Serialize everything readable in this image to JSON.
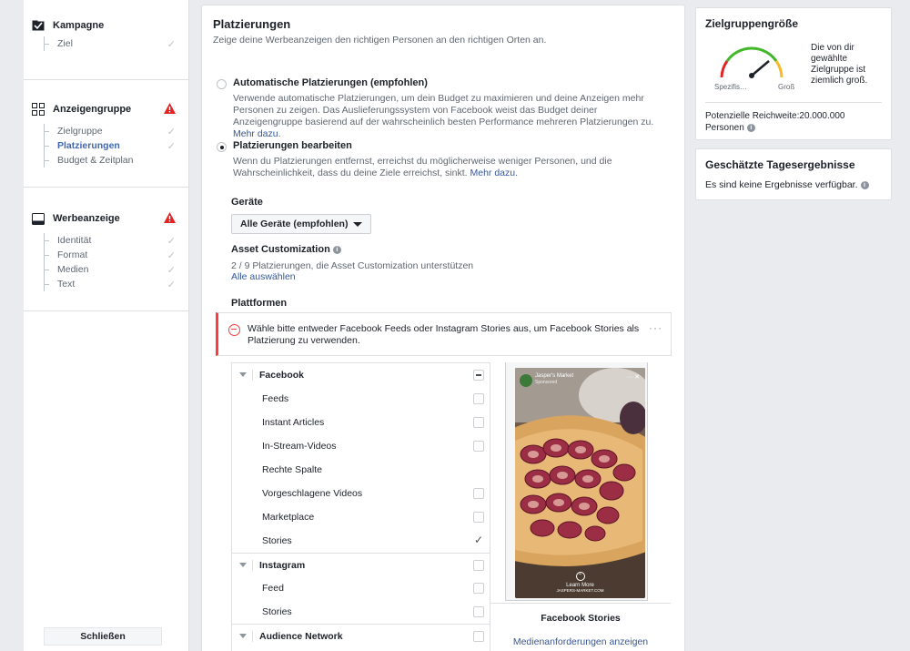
{
  "leftnav": {
    "sections": [
      {
        "title": "Kampagne",
        "icon": "campaign-icon",
        "warning": false,
        "items": [
          {
            "label": "Ziel",
            "active": false
          }
        ]
      },
      {
        "title": "Anzeigengruppe",
        "icon": "adset-icon",
        "warning": true,
        "items": [
          {
            "label": "Zielgruppe",
            "active": false
          },
          {
            "label": "Platzierungen",
            "active": true
          },
          {
            "label": "Budget & Zeitplan",
            "active": false
          }
        ]
      },
      {
        "title": "Werbeanzeige",
        "icon": "ad-icon",
        "warning": true,
        "items": [
          {
            "label": "Identität",
            "active": false
          },
          {
            "label": "Format",
            "active": false
          },
          {
            "label": "Medien",
            "active": false
          },
          {
            "label": "Text",
            "active": false
          }
        ]
      }
    ],
    "close_label": "Schließen"
  },
  "main": {
    "title": "Platzierungen",
    "subtitle": "Zeige deine Werbeanzeigen den richtigen Personen an den richtigen Orten an.",
    "auto": {
      "label": "Automatische Platzierungen (empfohlen)",
      "desc": "Verwende automatische Platzierungen, um dein Budget zu maximieren und deine Anzeigen mehr Personen zu zeigen. Das Auslieferungssystem von Facebook weist das Budget deiner Anzeigengruppe basierend auf der wahrscheinlich besten Performance mehreren Platzierungen zu.",
      "link": "Mehr dazu."
    },
    "edit": {
      "label": "Platzierungen bearbeiten",
      "desc": "Wenn du Platzierungen entfernst, erreichst du möglicherweise weniger Personen, und die Wahrscheinlichkeit, dass du deine Ziele erreichst, sinkt.",
      "link": "Mehr dazu."
    },
    "devices_label": "Geräte",
    "devices_value": "Alle Geräte (empfohlen)",
    "asset_label": "Asset Customization",
    "asset_text": "2 / 9 Platzierungen, die Asset Customization unterstützen",
    "asset_link": "Alle auswählen",
    "platforms_label": "Plattformen",
    "alert": "Wähle bitte entweder Facebook Feeds oder Instagram Stories aus, um Facebook Stories als Platzierung zu verwenden.",
    "alert_dots": "···",
    "tree": {
      "facebook": "Facebook",
      "fb_items": [
        "Feeds",
        "Instant Articles",
        "In-Stream-Videos",
        "Rechte Spalte",
        "Vorgeschlagene Videos",
        "Marketplace",
        "Stories"
      ],
      "instagram": "Instagram",
      "ig_items": [
        "Feed",
        "Stories"
      ],
      "audience": "Audience Network"
    },
    "preview": {
      "brand": "Jasper's Market",
      "sponsored": "Sponsored",
      "cta": "Learn More",
      "cta_url": "JASPERS-MARKET.COM",
      "caption": "Facebook Stories",
      "link": "Medienanforderungen anzeigen"
    }
  },
  "right": {
    "audience_title": "Zielgruppengröße",
    "audience_text": "Die von dir gewählte Zielgruppe ist ziemlich groß.",
    "gauge_left": "Spezifis…",
    "gauge_right": "Groß",
    "reach_label": "Potenzielle Reichweite:",
    "reach_value": "20.000.000",
    "reach_unit": "Personen",
    "results_title": "Geschätzte Tagesergebnisse",
    "results_text": "Es sind keine Ergebnisse verfügbar."
  }
}
